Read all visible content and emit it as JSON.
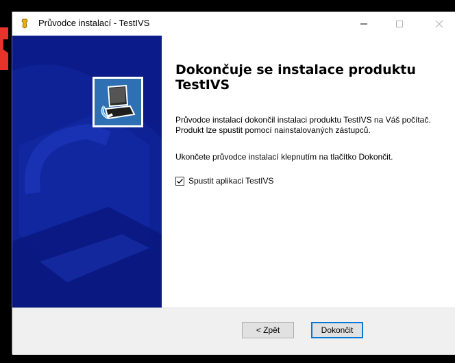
{
  "window": {
    "title": "Průvodce instalací - TestIVS"
  },
  "content": {
    "heading": "Dokončuje se instalace produktu TestIVS",
    "paragraph1": "Průvodce instalací dokončil instalaci produktu TestIVS na Váš počítač. Produkt lze spustit pomocí nainstalovaných zástupců.",
    "paragraph2": "Ukončete průvodce instalací klepnutím na tlačítko Dokončit.",
    "checkbox_label": "Spustit aplikaci TestIVS",
    "checkbox_checked": true
  },
  "buttons": {
    "back": "< Zpět",
    "finish": "Dokončit"
  },
  "colors": {
    "wizard_panel": "#0b1b8a",
    "accent": "#0078d7"
  }
}
